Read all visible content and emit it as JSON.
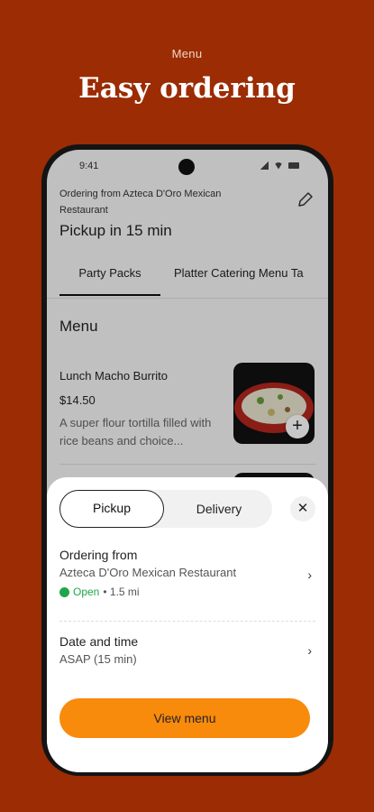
{
  "promo": {
    "kicker": "Menu",
    "title": "Easy ordering"
  },
  "status_bar": {
    "time": "9:41"
  },
  "header": {
    "ordering_from": "Ordering from Azteca D'Oro Mexican Restaurant",
    "pickup_time": "Pickup in 15 min",
    "edit_icon": "pencil-icon"
  },
  "tabs": [
    {
      "label": "Party Packs",
      "active": true
    },
    {
      "label": "Platter Catering Menu Ta"
    }
  ],
  "menu": {
    "heading": "Menu",
    "items": [
      {
        "name": "Lunch Macho Burrito",
        "price": "$14.50",
        "description": "A super flour tortilla filled with rice beans and choice..."
      }
    ]
  },
  "sheet": {
    "seg_pickup": "Pickup",
    "seg_delivery": "Delivery",
    "close_icon": "close-icon",
    "ordering_title": "Ordering from",
    "restaurant": "Azteca D'Oro Mexican Restaurant",
    "open_label": "Open",
    "distance": "• 1.5 mi",
    "date_title": "Date and time",
    "date_value": "ASAP (15 min)",
    "button": "View menu"
  },
  "colors": {
    "background": "#9b2c04",
    "accent": "#f88a0c",
    "open": "#1fa64b"
  }
}
